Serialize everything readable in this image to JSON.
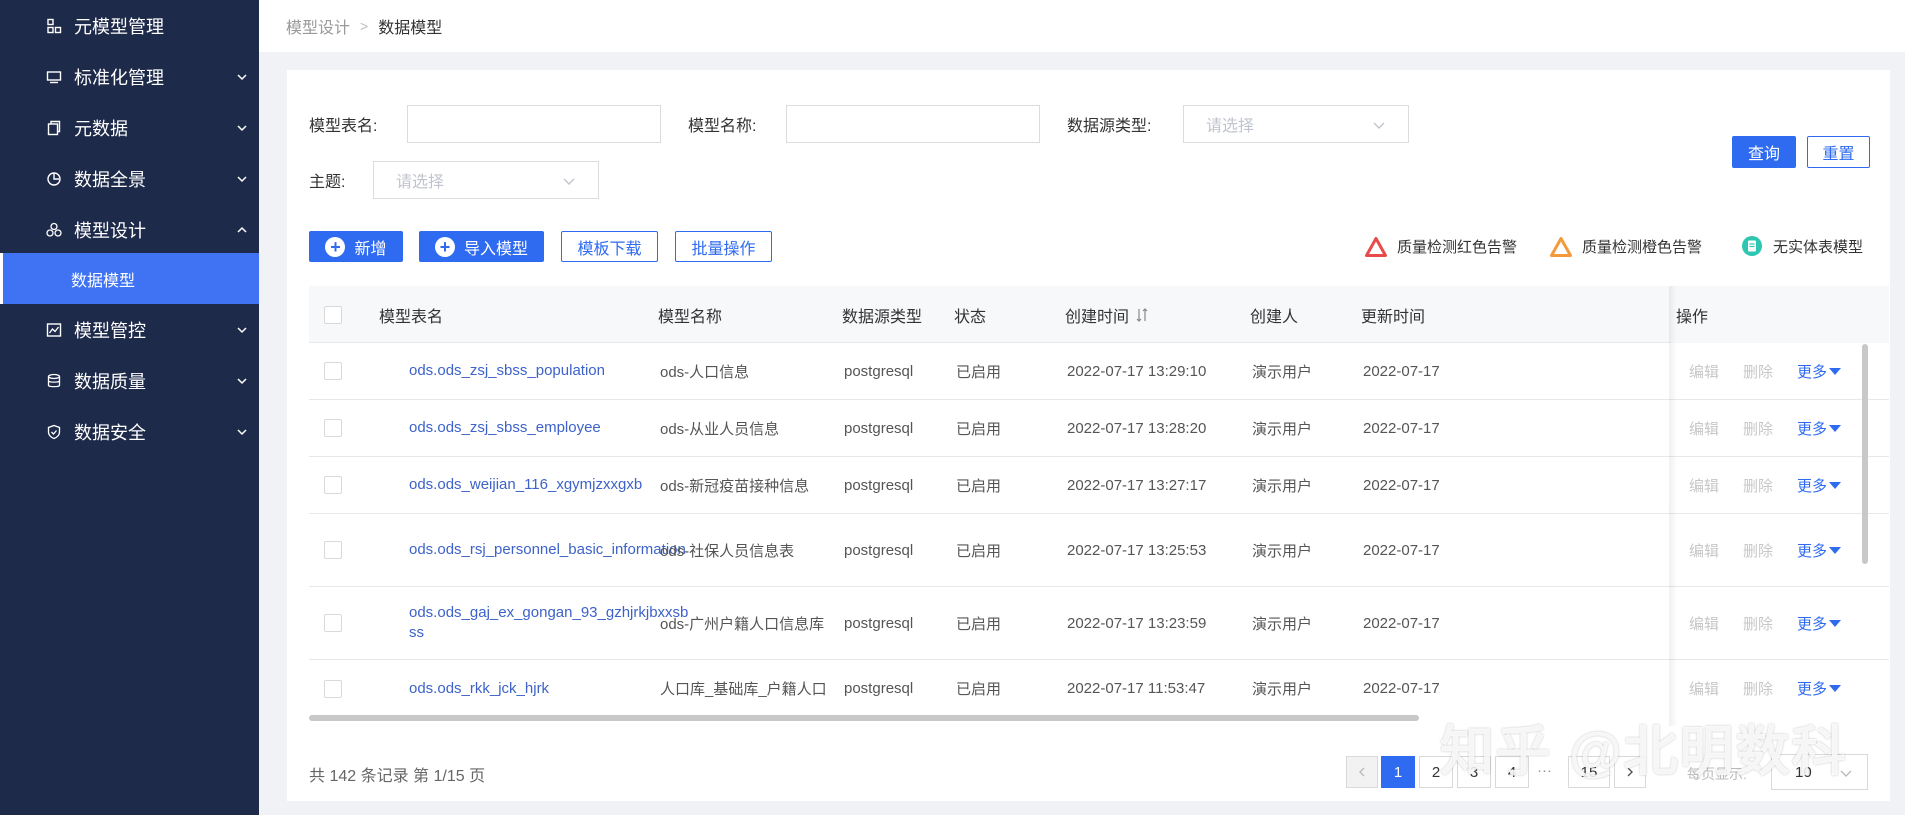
{
  "sidebar": {
    "items": [
      {
        "label": "元模型管理",
        "icon": "meta-model-icon",
        "expandable": false
      },
      {
        "label": "标准化管理",
        "icon": "monitor-icon",
        "expandable": true
      },
      {
        "label": "元数据",
        "icon": "copy-icon",
        "expandable": true
      },
      {
        "label": "数据全景",
        "icon": "pie-chart-icon",
        "expandable": true
      },
      {
        "label": "模型设计",
        "icon": "cluster-icon",
        "expandable": true,
        "expanded": true
      },
      {
        "label": "模型管控",
        "icon": "dashboard-icon",
        "expandable": true
      },
      {
        "label": "数据质量",
        "icon": "database-icon",
        "expandable": true
      },
      {
        "label": "数据安全",
        "icon": "shield-icon",
        "expandable": true
      }
    ],
    "active_sub": "数据模型"
  },
  "breadcrumb": {
    "parent": "模型设计",
    "separator": ">",
    "current": "数据模型"
  },
  "filters": {
    "table_name_label": "模型表名:",
    "model_name_label": "模型名称:",
    "datasource_label": "数据源类型:",
    "datasource_placeholder": "请选择",
    "theme_label": "主题:",
    "theme_placeholder": "请选择",
    "query_button": "查询",
    "reset_button": "重置"
  },
  "toolbar": {
    "add_button": "新增",
    "import_button": "导入模型",
    "template_button": "模板下载",
    "batch_button": "批量操作"
  },
  "legend": {
    "red_alert": "质量检测红色告警",
    "orange_alert": "质量检测橙色告警",
    "no_table": "无实体表模型",
    "colors": {
      "red": "#e84a4a",
      "orange": "#f59a3c",
      "teal": "#2ec6b0"
    }
  },
  "table": {
    "headers": {
      "table_name": "模型表名",
      "model_name": "模型名称",
      "datasource": "数据源类型",
      "status": "状态",
      "created": "创建时间",
      "creator": "创建人",
      "updated": "更新时间",
      "actions": "操作"
    },
    "rows": [
      {
        "table_name": "ods.ods_zsj_sbss_population",
        "model_name": "ods-人口信息",
        "datasource": "postgresql",
        "status": "已启用",
        "created": "2022-07-17 13:29:10",
        "creator": "演示用户",
        "updated": "2022-07-17"
      },
      {
        "table_name": "ods.ods_zsj_sbss_employee",
        "model_name": "ods-从业人员信息",
        "datasource": "postgresql",
        "status": "已启用",
        "created": "2022-07-17 13:28:20",
        "creator": "演示用户",
        "updated": "2022-07-17"
      },
      {
        "table_name": "ods.ods_weijian_116_xgymjzxxgxb",
        "model_name": "ods-新冠疫苗接种信息",
        "datasource": "postgresql",
        "status": "已启用",
        "created": "2022-07-17 13:27:17",
        "creator": "演示用户",
        "updated": "2022-07-17"
      },
      {
        "table_name": "ods.ods_rsj_personnel_basic_information",
        "model_name": "ods-社保人员信息表",
        "datasource": "postgresql",
        "status": "已启用",
        "created": "2022-07-17 13:25:53",
        "creator": "演示用户",
        "updated": "2022-07-17"
      },
      {
        "table_name": "ods.ods_gaj_ex_gongan_93_gzhjrkjbxxsbss",
        "model_name": "ods-广州户籍人口信息库",
        "datasource": "postgresql",
        "status": "已启用",
        "created": "2022-07-17 13:23:59",
        "creator": "演示用户",
        "updated": "2022-07-17"
      },
      {
        "table_name": "ods.ods_rkk_jck_hjrk",
        "model_name": "人口库_基础库_户籍人口",
        "datasource": "postgresql",
        "status": "已启用",
        "created": "2022-07-17 11:53:47",
        "creator": "演示用户",
        "updated": "2022-07-17"
      }
    ],
    "action_edit": "编辑",
    "action_delete": "删除",
    "action_more": "更多"
  },
  "pagination": {
    "summary": "共 142 条记录 第 1/15 页",
    "pages": [
      "1",
      "2",
      "3",
      "4"
    ],
    "ellipsis": "···",
    "last": "15",
    "current": "1",
    "per_page_label": "每页显示:",
    "per_page_value": "10"
  },
  "watermark": "知乎 @北明数科"
}
